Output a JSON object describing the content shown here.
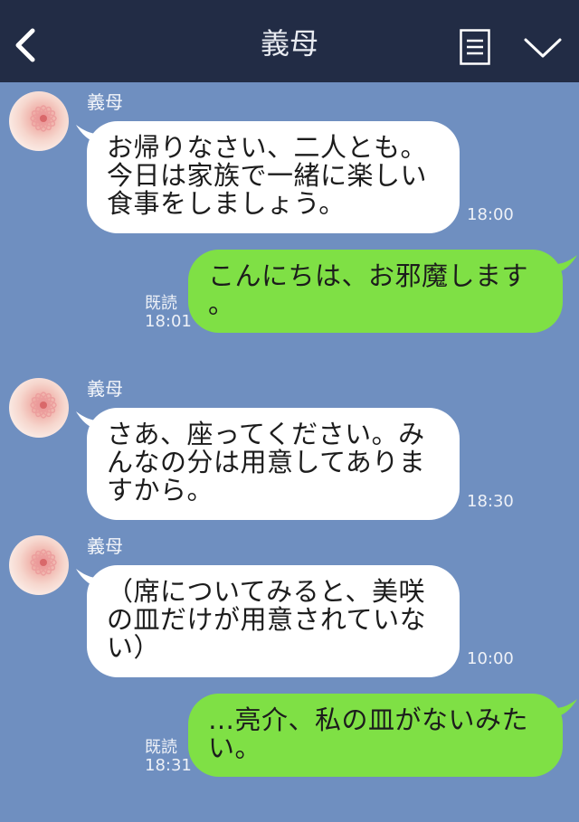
{
  "header": {
    "title": "義母"
  },
  "messages": [
    {
      "sender": "義母",
      "text": "お帰りなさい、二人とも。\n今日は家族で一緒に楽しい\n食事をしましょう。",
      "time": "18:00"
    },
    {
      "text": "こんにちは、お邪魔します\n。",
      "read": "既読",
      "time": "18:01"
    },
    {
      "sender": "義母",
      "text": "さあ、座ってください。み\nんなの分は用意してありま\nすから。",
      "time": "18:30"
    },
    {
      "sender": "義母",
      "text": "（席についてみると、美咲\nの皿だけが用意されていな\nい）",
      "time": "10:00"
    },
    {
      "text": "…亮介、私の皿がないみた\nい。",
      "read": "既読",
      "time": "18:31"
    }
  ],
  "colors": {
    "header_bg": "#222c45",
    "chat_bg": "#6f8fc0",
    "incoming_bubble": "#ffffff",
    "outgoing_bubble": "#7fe045"
  }
}
